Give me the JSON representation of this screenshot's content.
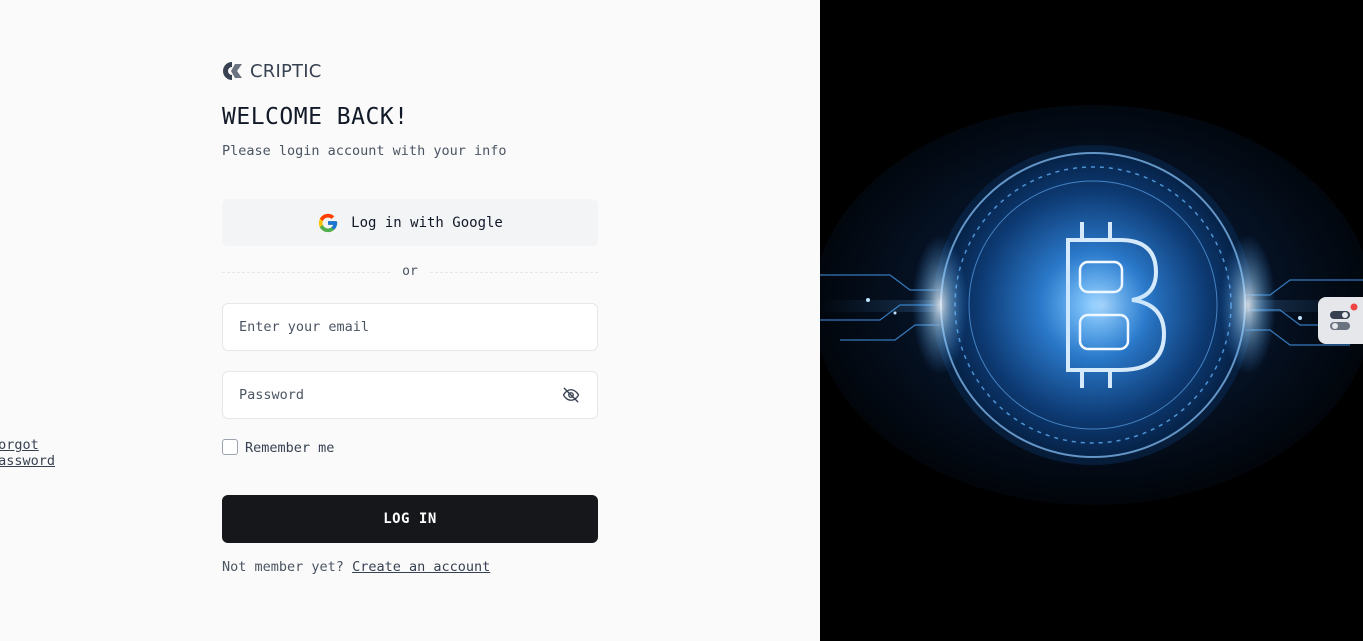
{
  "brand": {
    "name": "CRIPTIC"
  },
  "header": {
    "title": "WELCOME BACK!",
    "subtitle": "Please login account with your info"
  },
  "google_login": {
    "label": "Log in with Google",
    "icon": "google-icon"
  },
  "divider": {
    "text": "or"
  },
  "form": {
    "email": {
      "placeholder": "Enter your email",
      "value": ""
    },
    "password": {
      "placeholder": "Password",
      "value": "",
      "icon": "eye-off-icon"
    },
    "remember": {
      "label": "Remember me",
      "checked": false
    },
    "forgot": {
      "label": "Forgot Password"
    },
    "submit": {
      "label": "LOG IN"
    }
  },
  "signup": {
    "prompt": "Not member yet?",
    "link": "Create an account"
  },
  "hero": {
    "icon": "bitcoin-coin-image"
  },
  "widget": {
    "icon": "toggle-settings-icon"
  },
  "colors": {
    "primary_button": "#15171b",
    "google_button": "#f3f4f6",
    "accent_glow": "#3b9cff",
    "badge_dot": "#ef4444"
  }
}
